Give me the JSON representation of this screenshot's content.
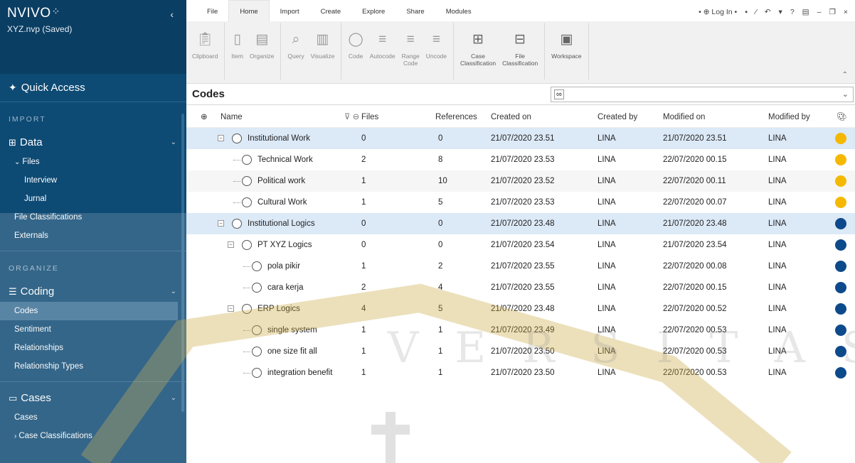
{
  "app": {
    "logo": "NVIVO",
    "logo_mark": "⁘",
    "collapse": "‹",
    "project": "XYZ.nvp (Saved)"
  },
  "sidebar": {
    "quick_access": "Quick Access",
    "sections": {
      "import": "IMPORT",
      "organize": "ORGANIZE"
    },
    "data": {
      "label": "Data",
      "items": {
        "files": "Files",
        "interview": "Interview",
        "jurnal": "Jurnal",
        "file_classifications": "File Classifications",
        "externals": "Externals"
      }
    },
    "coding": {
      "label": "Coding",
      "items": {
        "codes": "Codes",
        "sentiment": "Sentiment",
        "relationships": "Relationships",
        "relationship_types": "Relationship Types"
      }
    },
    "cases": {
      "label": "Cases",
      "items": {
        "cases": "Cases",
        "case_classifications": "Case Classifications"
      }
    }
  },
  "tabs": [
    "File",
    "Home",
    "Import",
    "Create",
    "Explore",
    "Share",
    "Modules"
  ],
  "active_tab": "Home",
  "titlebar_controls": {
    "login": "• ⊕ Log In •"
  },
  "ribbon": {
    "clipboard": "Clipboard",
    "item": "Item",
    "organize": "Organize",
    "query": "Query",
    "visualize": "Visualize",
    "code": "Code",
    "autocode": "Autocode",
    "range_code_1": "Range",
    "range_code_2": "Code",
    "uncode": "Uncode",
    "case_class_1": "Case",
    "case_class_2": "Classification",
    "file_class_1": "File",
    "file_class_2": "Classification",
    "workspace": "Workspace"
  },
  "codes_view": {
    "title": "Codes",
    "search_value": "",
    "columns": {
      "name": "Name",
      "files": "Files",
      "references": "References",
      "created_on": "Created on",
      "created_by": "Created by",
      "modified_on": "Modified on",
      "modified_by": "Modified by"
    },
    "rows": [
      {
        "name": "Institutional Work",
        "files": "0",
        "references": "0",
        "created_on": "21/07/2020 23.51",
        "created_by": "LINA",
        "modified_on": "21/07/2020 23.51",
        "modified_by": "LINA",
        "color": "#f5b800"
      },
      {
        "name": "Technical Work",
        "files": "2",
        "references": "8",
        "created_on": "21/07/2020 23.53",
        "created_by": "LINA",
        "modified_on": "22/07/2020 00.15",
        "modified_by": "LINA",
        "color": "#f5b800"
      },
      {
        "name": "Political work",
        "files": "1",
        "references": "10",
        "created_on": "21/07/2020 23.52",
        "created_by": "LINA",
        "modified_on": "22/07/2020 00.11",
        "modified_by": "LINA",
        "color": "#f5b800"
      },
      {
        "name": "Cultural Work",
        "files": "1",
        "references": "5",
        "created_on": "21/07/2020 23.53",
        "created_by": "LINA",
        "modified_on": "22/07/2020 00.07",
        "modified_by": "LINA",
        "color": "#f5b800"
      },
      {
        "name": "Institutional Logics",
        "files": "0",
        "references": "0",
        "created_on": "21/07/2020 23.48",
        "created_by": "LINA",
        "modified_on": "21/07/2020 23.48",
        "modified_by": "LINA",
        "color": "#0d4a8c"
      },
      {
        "name": "PT XYZ Logics",
        "files": "0",
        "references": "0",
        "created_on": "21/07/2020 23.54",
        "created_by": "LINA",
        "modified_on": "21/07/2020 23.54",
        "modified_by": "LINA",
        "color": "#0d4a8c"
      },
      {
        "name": "pola pikir",
        "files": "1",
        "references": "2",
        "created_on": "21/07/2020 23.55",
        "created_by": "LINA",
        "modified_on": "22/07/2020 00.08",
        "modified_by": "LINA",
        "color": "#0d4a8c"
      },
      {
        "name": "cara kerja",
        "files": "2",
        "references": "4",
        "created_on": "21/07/2020 23.55",
        "created_by": "LINA",
        "modified_on": "22/07/2020 00.15",
        "modified_by": "LINA",
        "color": "#0d4a8c"
      },
      {
        "name": "ERP Logics",
        "files": "4",
        "references": "5",
        "created_on": "21/07/2020 23.48",
        "created_by": "LINA",
        "modified_on": "22/07/2020 00.52",
        "modified_by": "LINA",
        "color": "#0d4a8c"
      },
      {
        "name": "single system",
        "files": "1",
        "references": "1",
        "created_on": "21/07/2020 23.49",
        "created_by": "LINA",
        "modified_on": "22/07/2020 00.53",
        "modified_by": "LINA",
        "color": "#0d4a8c"
      },
      {
        "name": "one size fit all",
        "files": "1",
        "references": "1",
        "created_on": "21/07/2020 23.50",
        "created_by": "LINA",
        "modified_on": "22/07/2020 00.53",
        "modified_by": "LINA",
        "color": "#0d4a8c"
      },
      {
        "name": "integration benefit",
        "files": "1",
        "references": "1",
        "created_on": "21/07/2020 23.50",
        "created_by": "LINA",
        "modified_on": "22/07/2020 00.53",
        "modified_by": "LINA",
        "color": "#0d4a8c"
      }
    ]
  },
  "watermark": {
    "letters": "V E R S I T A S   K A T O L"
  }
}
